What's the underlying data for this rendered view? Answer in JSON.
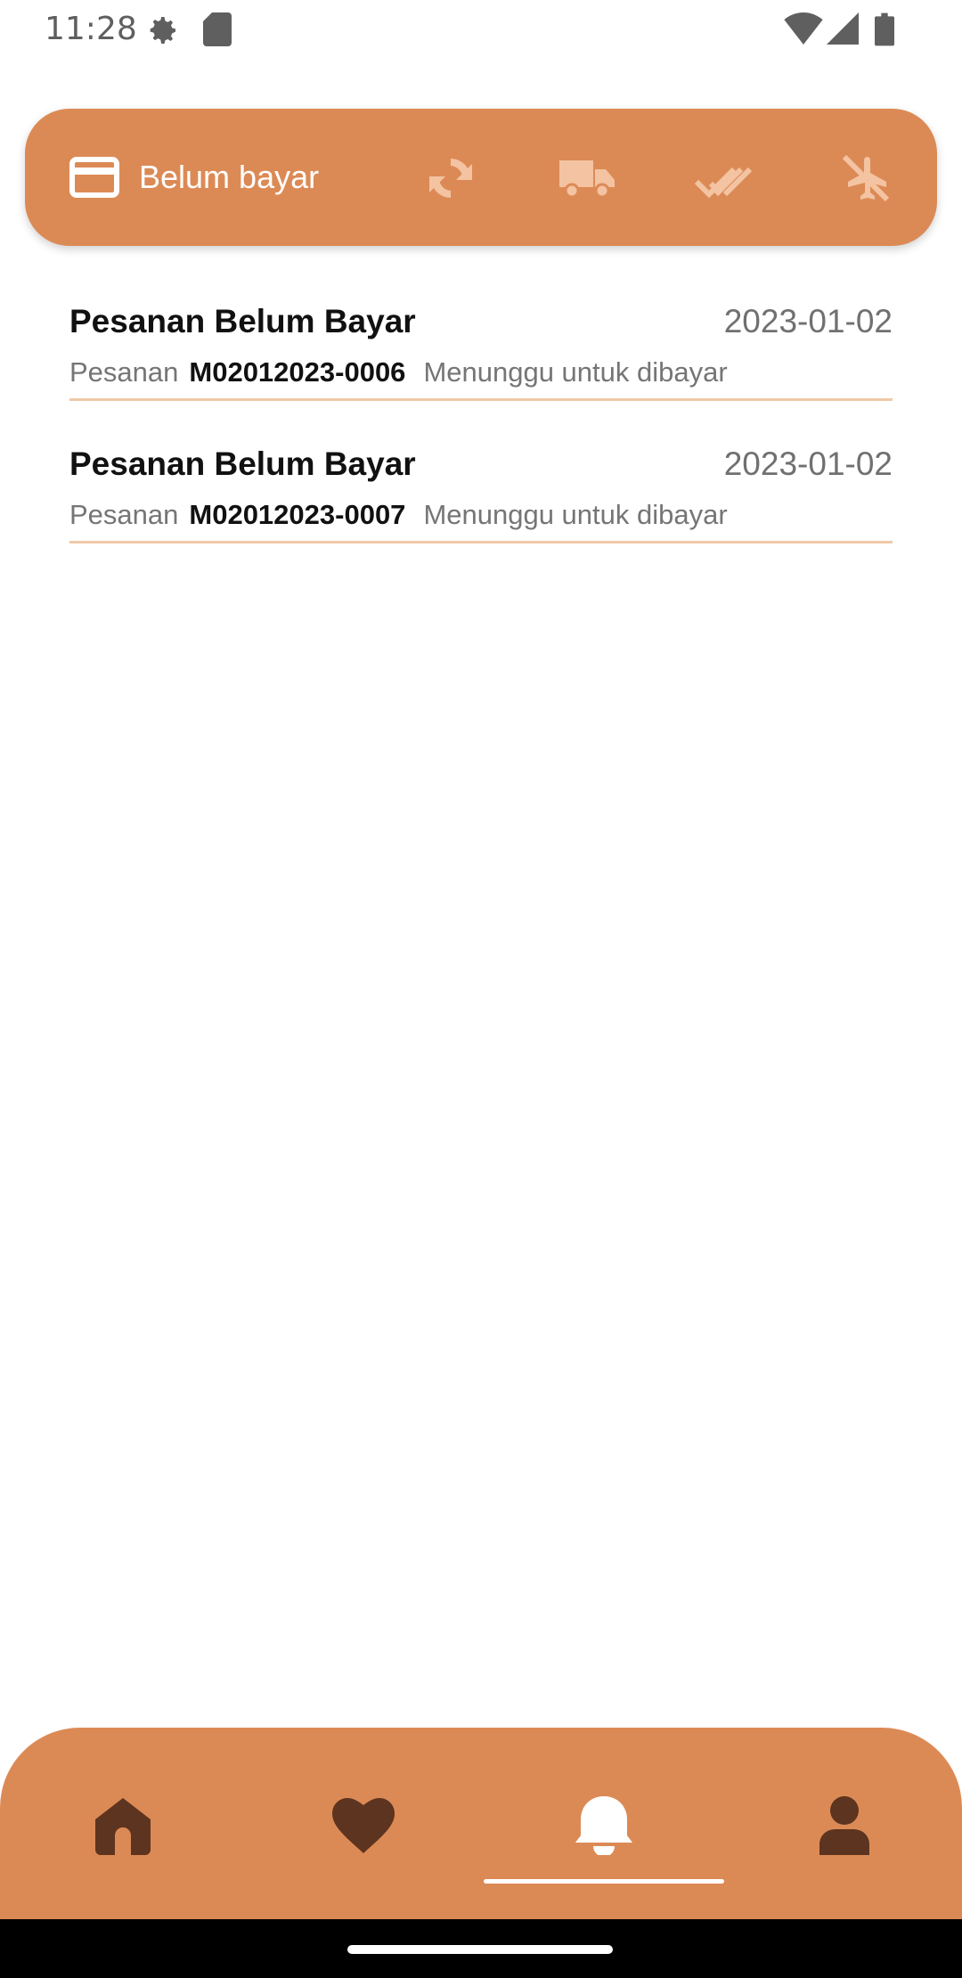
{
  "status_bar": {
    "time": "11:28",
    "icons": [
      "settings-gear-icon",
      "sd-card-icon",
      "wifi-icon",
      "signal-icon",
      "battery-icon"
    ]
  },
  "tabs": {
    "active": {
      "icon": "credit-card-icon",
      "label": "Belum bayar"
    },
    "others": [
      "refresh-icon",
      "truck-icon",
      "double-check-icon",
      "cancel-flight-icon"
    ]
  },
  "orders": [
    {
      "title": "Pesanan Belum Bayar",
      "date": "2023-01-02",
      "prefix": "Pesanan",
      "code": "M02012023-0006",
      "status": "Menunggu untuk dibayar"
    },
    {
      "title": "Pesanan Belum Bayar",
      "date": "2023-01-02",
      "prefix": "Pesanan",
      "code": "M02012023-0007",
      "status": "Menunggu untuk dibayar"
    }
  ],
  "bottom_nav": {
    "items": [
      "home-icon",
      "heart-icon",
      "bell-icon",
      "person-icon"
    ],
    "active": "bell-icon"
  },
  "colors": {
    "accent": "#dc8a55",
    "accent_dark": "#5c3420",
    "divider": "#f0c9a8"
  }
}
